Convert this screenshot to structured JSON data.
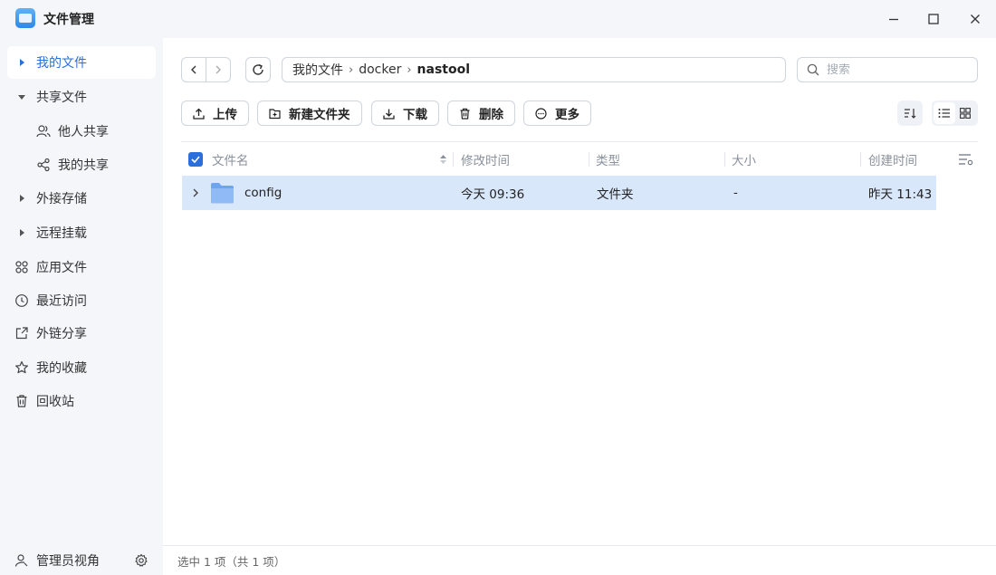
{
  "window": {
    "title": "文件管理",
    "controls": [
      "minimize-icon",
      "maximize-icon",
      "close-icon"
    ]
  },
  "sidebar": {
    "items": [
      {
        "label": "我的文件",
        "icon": "caret-right-icon",
        "active": true
      },
      {
        "label": "共享文件",
        "icon": "caret-down-icon",
        "active": false
      },
      {
        "label": "他人共享",
        "icon": "users-icon",
        "sub": true
      },
      {
        "label": "我的共享",
        "icon": "share-icon",
        "sub": true
      },
      {
        "label": "外接存储",
        "icon": "caret-right-icon"
      },
      {
        "label": "远程挂载",
        "icon": "caret-right-icon"
      },
      {
        "label": "应用文件",
        "icon": "apps-icon"
      },
      {
        "label": "最近访问",
        "icon": "clock-icon"
      },
      {
        "label": "外链分享",
        "icon": "external-link-icon"
      },
      {
        "label": "我的收藏",
        "icon": "star-icon"
      },
      {
        "label": "回收站",
        "icon": "trash-icon"
      }
    ],
    "footer": {
      "label": "管理员视角",
      "icon": "admin-icon",
      "settings_icon": "gear-icon"
    }
  },
  "path": {
    "segments": [
      "我的文件",
      "docker"
    ],
    "current": "nastool"
  },
  "search": {
    "placeholder": "搜索",
    "value": ""
  },
  "toolbar": {
    "upload": "上传",
    "new_folder": "新建文件夹",
    "download": "下载",
    "delete": "删除",
    "more": "更多"
  },
  "table": {
    "columns": [
      "文件名",
      "修改时间",
      "类型",
      "大小",
      "创建时间"
    ],
    "rows": [
      {
        "name": "config",
        "modified": "今天 09:36",
        "type": "文件夹",
        "size": "-",
        "created": "昨天 11:43",
        "selected": true
      }
    ]
  },
  "status": {
    "text": "选中 1 项（共 1 项）"
  },
  "colors": {
    "accent": "#2a6fdb",
    "selected_row": "#d9e7fb",
    "sidebar_bg": "#f4f6f9"
  }
}
